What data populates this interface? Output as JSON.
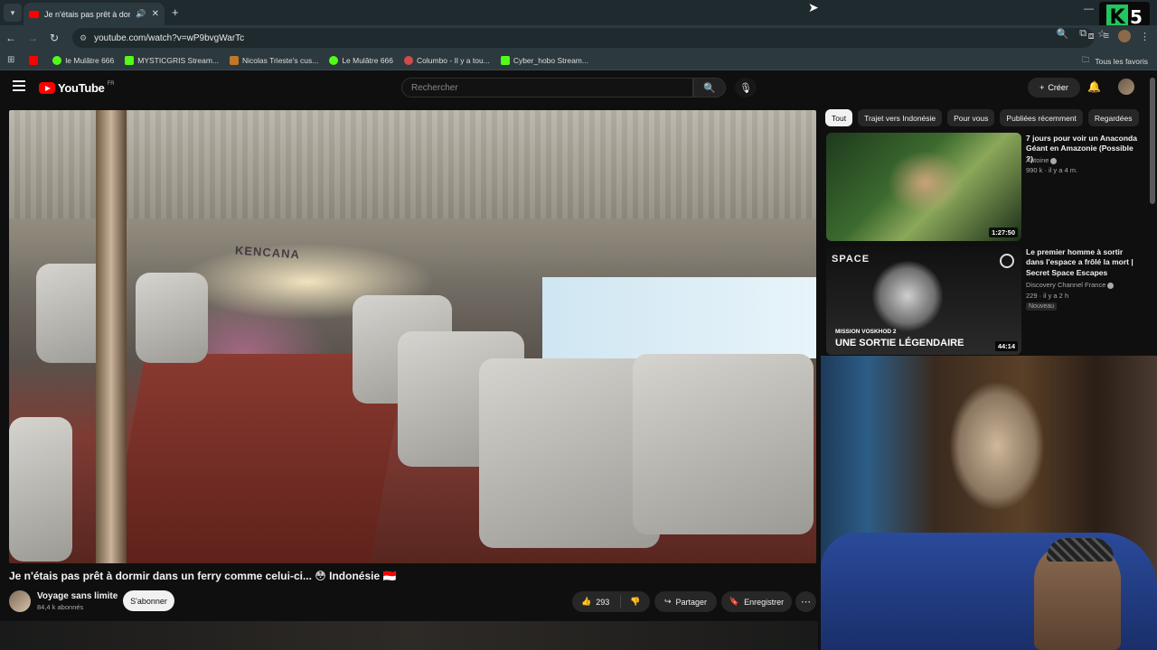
{
  "browser": {
    "tab_title": "Je n'étais pas prêt à dormir dans un ferry comme celui-ci...",
    "url": "youtube.com/watch?v=wP9bvgWarTc",
    "bookmarks": [
      {
        "label": "",
        "color": "#ff0000"
      },
      {
        "label": "le Mulâtre 666",
        "color": "#53fc18"
      },
      {
        "label": "MYSTICGRIS Stream...",
        "color": "#53fc18"
      },
      {
        "label": "Nicolas Trieste's cus...",
        "color": "#c0772a"
      },
      {
        "label": "Le Mulâtre 666",
        "color": "#53fc18"
      },
      {
        "label": "Columbo - Il y a tou...",
        "color": "#d44a4a"
      },
      {
        "label": "Cyber_hobo Stream...",
        "color": "#53fc18"
      }
    ],
    "bookmarks_right": "Tous les favoris"
  },
  "overlay_logo": {
    "letter": "K",
    "number": "5"
  },
  "youtube": {
    "logo_text": "YouTube",
    "region": "FR",
    "search_placeholder": "Rechercher",
    "create_label": "Créer"
  },
  "video": {
    "stage_sign": "KENCANA",
    "title": "Je n'étais pas prêt à dormir dans un ferry comme celui-ci... 😳 Indonésie 🇮🇩",
    "channel": "Voyage sans limite",
    "subscribers": "84,4 k abonnés",
    "subscribe_label": "S'abonner",
    "likes": "293",
    "share_label": "Partager",
    "save_label": "Enregistrer"
  },
  "chips": [
    "Tout",
    "Trajet vers Indonésie",
    "Pour vous",
    "Publiées récemment",
    "Regardées"
  ],
  "recommendations": [
    {
      "title": "7 jours pour voir un Anaconda Géant en Amazonie (Possible ?)",
      "channel": "Antoine",
      "meta": "990 k · il y a 4 m.",
      "duration": "1:27:50",
      "badge": ""
    },
    {
      "title": "Le premier homme à sortir dans l'espace a frôlé la mort | Secret Space Escapes",
      "channel": "Discovery Channel France",
      "meta": "229 · il y a 2 h",
      "duration": "44:14",
      "badge": "Nouveau",
      "thumb_label": "SPACE",
      "thumb_sub": "MISSION VOSKHOD 2",
      "thumb_headline": "UNE SORTIE LÉGENDAIRE"
    }
  ]
}
